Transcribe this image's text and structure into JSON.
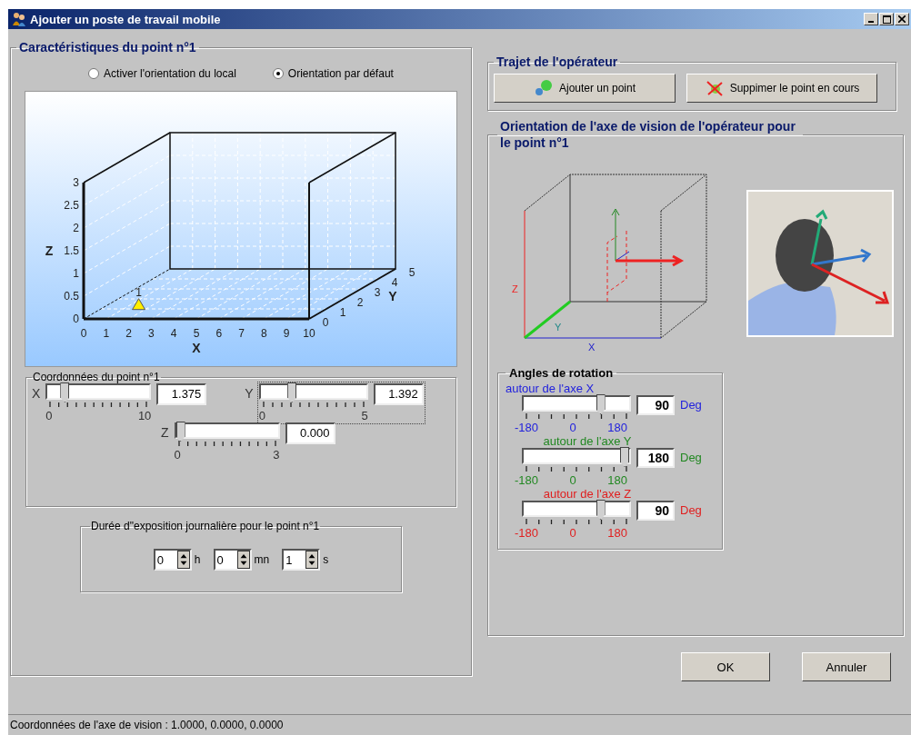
{
  "window": {
    "title": "Ajouter un poste de travail mobile"
  },
  "point_group": {
    "title": "Caractéristiques du point n°1",
    "orientation_options": [
      {
        "label": "Activer l'orientation du local",
        "selected": false
      },
      {
        "label": "Orientation par défaut",
        "selected": true
      }
    ],
    "plot": {
      "x_ticks": [
        "0",
        "1",
        "2",
        "3",
        "4",
        "5",
        "6",
        "7",
        "8",
        "9",
        "10"
      ],
      "y_ticks": [
        "0",
        "1",
        "2",
        "3",
        "4",
        "5"
      ],
      "z_ticks": [
        "3",
        "2.5",
        "2",
        "1.5",
        "1",
        "0.5",
        "0"
      ],
      "x_label": "X",
      "y_label": "Y",
      "z_label": "Z",
      "point_label": "1"
    },
    "coordinates": {
      "title": "Coordonnées du point n°1",
      "axes": [
        {
          "label": "X",
          "value": "1.375",
          "level": 0.1375,
          "min": "0",
          "max": "10",
          "focused": false
        },
        {
          "label": "Y",
          "value": "1.392",
          "level": 0.2784,
          "min": "0",
          "max": "5",
          "focused": true
        },
        {
          "label": "Z",
          "value": "0.000",
          "level": 0,
          "min": "0",
          "max": "3",
          "focused": false
        }
      ]
    },
    "duration": {
      "title": "Durée d\"exposition journalière pour le point n°1",
      "fields": [
        {
          "value": "0",
          "unit": "h"
        },
        {
          "value": "0",
          "unit": "mn"
        },
        {
          "value": "1",
          "unit": "s"
        }
      ]
    }
  },
  "route_group": {
    "title": "Trajet de l'opérateur",
    "buttons": [
      {
        "label": "Ajouter un point",
        "kind": "add"
      },
      {
        "label": "Suppimer le point en cours",
        "kind": "delete"
      }
    ]
  },
  "vision_group": {
    "title": "Orientation de l'axe de vision de l'opérateur pour le point n°1",
    "diagram_labels": {
      "z": "Z",
      "y": "Y",
      "x": "X"
    },
    "rotation": {
      "title": "Angles de rotation",
      "axes": [
        {
          "caption": "autour de l'axe X",
          "color": "#2222dd",
          "value": "90",
          "unit": "Deg",
          "level": 0.75,
          "min": "-180",
          "mid": "0",
          "max": "180"
        },
        {
          "caption": "autour de l'axe Y",
          "color": "#228822",
          "value": "180",
          "unit": "Deg",
          "level": 1,
          "min": "-180",
          "mid": "0",
          "max": "180"
        },
        {
          "caption": "autour de l'axe Z",
          "color": "#e02020",
          "value": "90",
          "unit": "Deg",
          "level": 0.75,
          "min": "-180",
          "mid": "0",
          "max": "180"
        }
      ]
    }
  },
  "buttons": [
    "OK",
    "Annuler"
  ],
  "status_bar": "Coordonnées de l'axe de vision : 1.0000, 0.0000, 0.0000"
}
